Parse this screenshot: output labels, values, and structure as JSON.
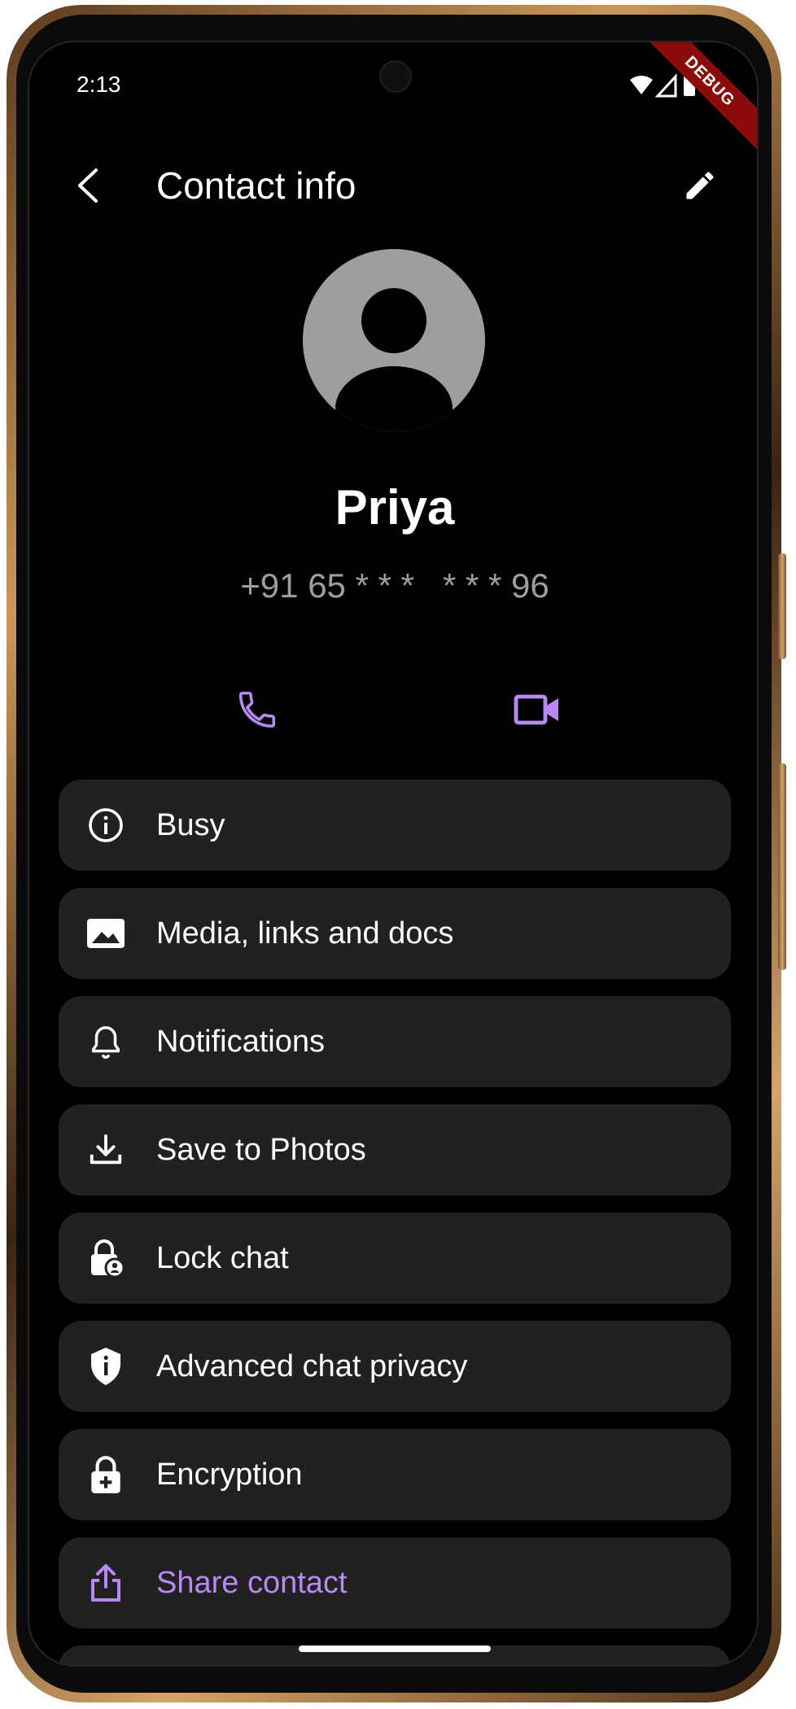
{
  "status_bar": {
    "time": "2:13",
    "debug_label": "DEBUG",
    "icons": [
      "wifi-icon",
      "cell-signal-icon",
      "battery-icon"
    ]
  },
  "app_bar": {
    "back_icon": "chevron-left-icon",
    "title": "Contact info",
    "edit_icon": "pencil-icon"
  },
  "contact": {
    "avatar_icon": "person-avatar-icon",
    "name": "Priya",
    "phone": "+91 65 * * *   * * * 96"
  },
  "actions": [
    {
      "name": "voice-call",
      "icon": "phone-icon"
    },
    {
      "name": "video-call",
      "icon": "video-camera-icon"
    }
  ],
  "menu": [
    {
      "label": "Busy",
      "icon": "info-icon"
    },
    {
      "label": "Media, links and docs",
      "icon": "image-icon"
    },
    {
      "label": "Notifications",
      "icon": "bell-icon"
    },
    {
      "label": "Save to Photos",
      "icon": "download-icon"
    },
    {
      "label": "Lock chat",
      "icon": "lock-person-icon"
    },
    {
      "label": "Advanced chat privacy",
      "icon": "shield-info-icon"
    },
    {
      "label": "Encryption",
      "icon": "lock-plus-icon"
    },
    {
      "label": "Share contact",
      "icon": "share-icon"
    }
  ],
  "colors": {
    "background": "#000000",
    "card": "#212121",
    "accent": "#b889f2",
    "muted_text": "#9e9e9e",
    "avatar": "#9e9e9e",
    "debug_ribbon": "#8b0b0b"
  }
}
